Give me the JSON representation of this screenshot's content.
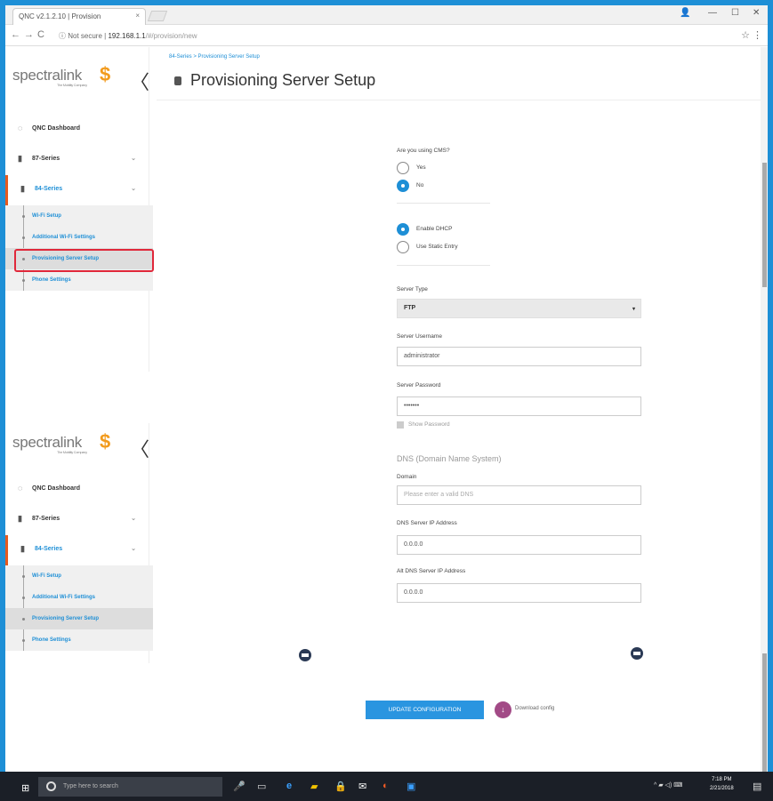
{
  "browser": {
    "tab_title": "QNC v2.1.2.10 | Provision",
    "tab_close": "×",
    "url_prefix": "Not secure",
    "url_host": "192.168.1.1",
    "url_path": "/#/provision/new",
    "win_min": "—",
    "win_max": "☐",
    "win_close": "✕",
    "profile": "👤",
    "back": "←",
    "forward": "→",
    "reload": "C",
    "info": "ⓘ",
    "star": "☆",
    "menu": "⋮"
  },
  "sidebar": {
    "logo": "spectralink",
    "logo_tagline": "The Mobility Company",
    "logo_mark": "$",
    "collapse": "〈",
    "items": [
      {
        "label": "QNC Dashboard",
        "icon": "◌"
      },
      {
        "label": "87-Series",
        "icon": "▮"
      },
      {
        "label": "84-Series",
        "icon": "▮"
      }
    ],
    "sub_items": [
      {
        "label": "Wi-Fi Setup"
      },
      {
        "label": "Additional Wi-Fi Settings"
      },
      {
        "label": "Provisioning Server Setup"
      },
      {
        "label": "Phone Settings"
      }
    ],
    "chevron": "⌄"
  },
  "main": {
    "breadcrumb": "84-Series > Provisioning Server Setup",
    "title": "Provisioning Server Setup",
    "cms_question": "Are you using CMS?",
    "cms_yes": "Yes",
    "cms_no": "No",
    "dhcp": "Enable DHCP",
    "static": "Use Static Entry",
    "server_type_label": "Server Type",
    "server_type_value": "FTP",
    "select_caret": "▾",
    "username_label": "Server Username",
    "username_value": "administrator",
    "password_label": "Server Password",
    "password_value": "•••••••",
    "show_password": "Show Password",
    "dns_heading": "DNS (Domain Name System)",
    "domain_label": "Domain",
    "domain_placeholder": "Please enter a valid DNS",
    "dns_ip_label": "DNS Server IP Address",
    "dns_ip_value": "0.0.0.0",
    "alt_dns_label": "Alt DNS Server IP Address",
    "alt_dns_value": "0.0.0.0",
    "update_btn": "UPDATE CONFIGURATION",
    "download_label": "Download config",
    "download_icon": "↓"
  },
  "taskbar": {
    "start": "⊞",
    "search_placeholder": "Type here to search",
    "time": "7:18 PM",
    "date": "2/21/2018",
    "tray": "^ ▰ ◁) ⌨",
    "notifications": "▤",
    "icons": [
      "🎤",
      "▭",
      "e",
      "▰",
      "🔒",
      "✉",
      "◐",
      "▣"
    ]
  },
  "colors": {
    "accent": "#1e8fd6",
    "highlight": "#e0283a",
    "active_border": "#e65a1f",
    "button": "#2a95e0"
  }
}
